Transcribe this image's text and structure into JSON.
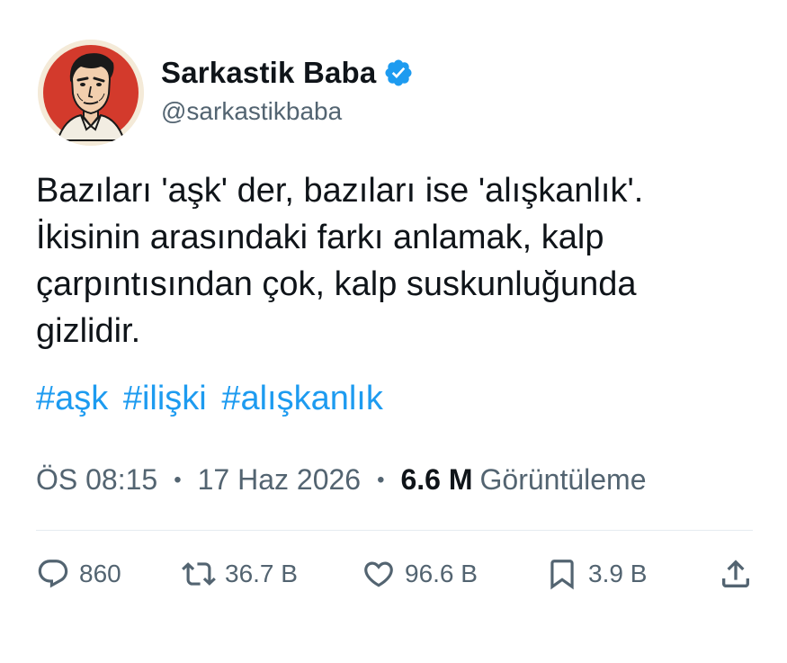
{
  "author": {
    "display_name": "Sarkastik Baba",
    "handle": "@sarkastikbaba",
    "verified": true
  },
  "tweet": {
    "text_lines": [
      "Bazıları 'aşk' der, bazıları ise 'alışkanlık'.",
      "İkisinin arasındaki farkı anlamak, kalp",
      "çarpıntısından çok, kalp suskunluğunda",
      "gizlidir."
    ],
    "hashtags": [
      "#aşk",
      "#ilişki",
      "#alışkanlık"
    ]
  },
  "meta": {
    "time": "ÖS 08:15",
    "separator": "•",
    "date": "17 Haz 2026",
    "views_count": "6.6 M",
    "views_label": "Görüntüleme"
  },
  "actions": {
    "replies": "860",
    "retweets": "36.7 B",
    "likes": "96.6 B",
    "bookmarks": "3.9 B"
  },
  "colors": {
    "accent": "#1d9bf0",
    "text": "#0f1419",
    "muted": "#536471",
    "avatar_bg": "#d33a2c"
  },
  "icons": {
    "avatar": "man-portrait-illustration",
    "verified": "verified-badge-icon",
    "reply": "reply-icon",
    "retweet": "retweet-icon",
    "like": "heart-icon",
    "bookmark": "bookmark-icon",
    "share": "share-icon"
  }
}
